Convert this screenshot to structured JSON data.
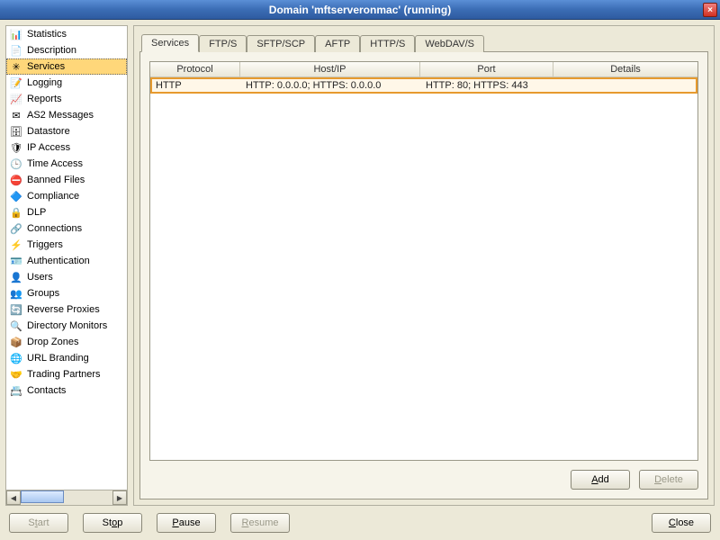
{
  "window": {
    "title": "Domain 'mftserveronmac' (running)",
    "close": "×"
  },
  "sidebar": {
    "items": [
      {
        "label": "Statistics",
        "icon": "📊"
      },
      {
        "label": "Description",
        "icon": "📄"
      },
      {
        "label": "Services",
        "icon": "✳",
        "selected": true
      },
      {
        "label": "Logging",
        "icon": "📝"
      },
      {
        "label": "Reports",
        "icon": "📈"
      },
      {
        "label": "AS2 Messages",
        "icon": "✉"
      },
      {
        "label": "Datastore",
        "icon": "🗄"
      },
      {
        "label": "IP Access",
        "icon": "🛡"
      },
      {
        "label": "Time Access",
        "icon": "🕒"
      },
      {
        "label": "Banned Files",
        "icon": "⛔"
      },
      {
        "label": "Compliance",
        "icon": "🔷"
      },
      {
        "label": "DLP",
        "icon": "🔒"
      },
      {
        "label": "Connections",
        "icon": "🔗"
      },
      {
        "label": "Triggers",
        "icon": "⚡"
      },
      {
        "label": "Authentication",
        "icon": "🪪"
      },
      {
        "label": "Users",
        "icon": "👤"
      },
      {
        "label": "Groups",
        "icon": "👥"
      },
      {
        "label": "Reverse Proxies",
        "icon": "🔄"
      },
      {
        "label": "Directory Monitors",
        "icon": "🔍"
      },
      {
        "label": "Drop Zones",
        "icon": "📦"
      },
      {
        "label": "URL Branding",
        "icon": "🌐"
      },
      {
        "label": "Trading Partners",
        "icon": "🤝"
      },
      {
        "label": "Contacts",
        "icon": "📇"
      }
    ]
  },
  "tabs": [
    {
      "label": "Services",
      "active": true
    },
    {
      "label": "FTP/S"
    },
    {
      "label": "SFTP/SCP"
    },
    {
      "label": "AFTP"
    },
    {
      "label": "HTTP/S"
    },
    {
      "label": "WebDAV/S"
    }
  ],
  "table": {
    "columns": [
      "Protocol",
      "Host/IP",
      "Port",
      "Details"
    ],
    "rows": [
      {
        "protocol": "HTTP",
        "host": "HTTP: 0.0.0.0; HTTPS: 0.0.0.0",
        "port": "HTTP: 80; HTTPS: 443",
        "details": ""
      }
    ]
  },
  "panel_buttons": {
    "add": "Add",
    "delete": "Delete"
  },
  "bottom": {
    "start": "Start",
    "stop": "Stop",
    "pause": "Pause",
    "resume": "Resume",
    "close": "Close"
  }
}
